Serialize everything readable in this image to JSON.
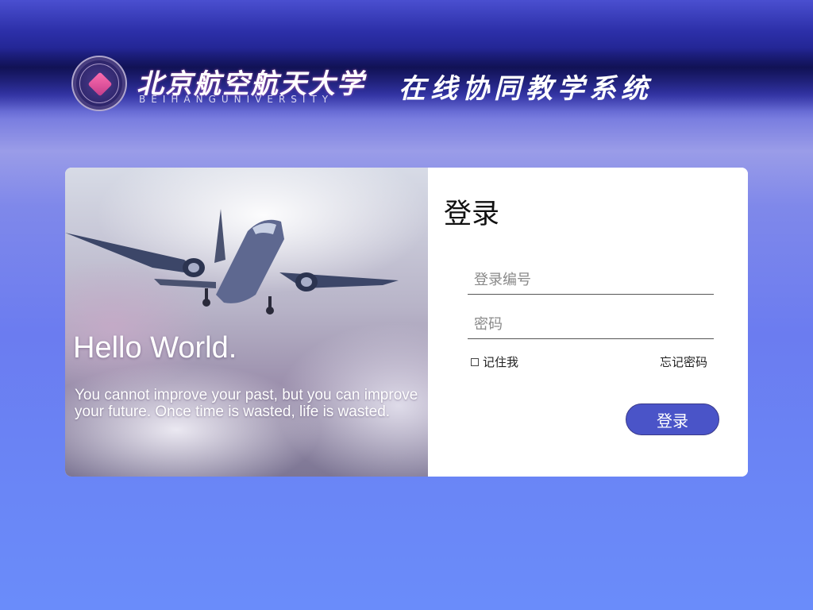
{
  "header": {
    "university_name": "北京航空航天大学",
    "university_en": "BEIHANGUNIVERSITY",
    "system_title": "在线协同教学系统",
    "logo_icon": "university-seal-icon"
  },
  "hero": {
    "title": "Hello World.",
    "quote": "You cannot improve your past, but you can improve your future. Once time is wasted, life is wasted."
  },
  "login": {
    "title": "登录",
    "id_placeholder": "登录编号",
    "password_placeholder": "密码",
    "remember_label": "记住我",
    "forgot_label": "忘记密码",
    "submit_label": "登录"
  },
  "colors": {
    "accent_button": "#4a54c8",
    "background_bottom": "#6a8cfa"
  }
}
